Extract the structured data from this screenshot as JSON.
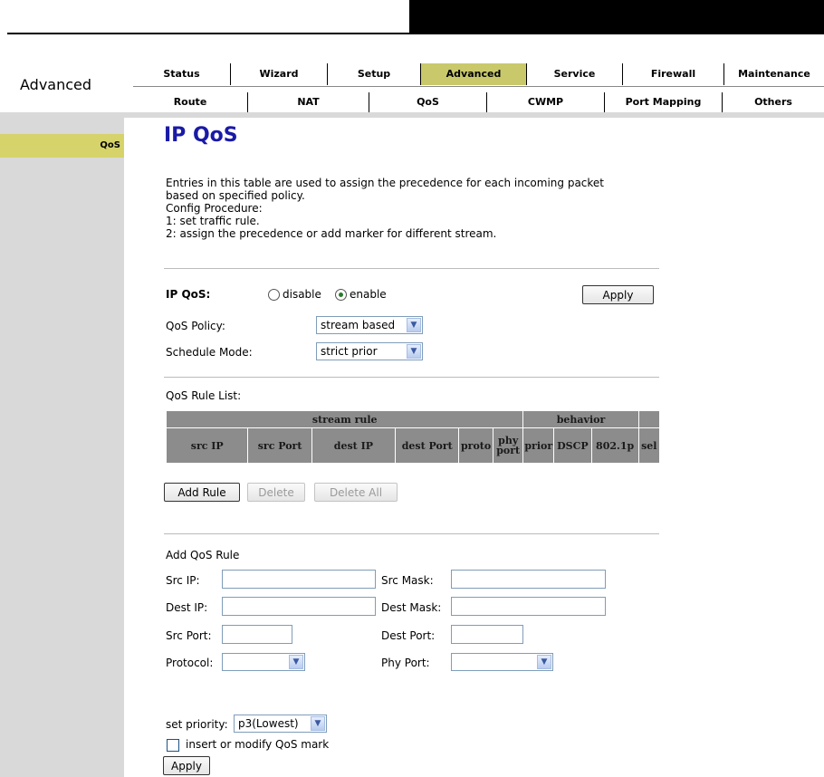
{
  "header": {
    "section_title": "Advanced",
    "main_tabs": [
      "Status",
      "Wizard",
      "Setup",
      "Advanced",
      "Service",
      "Firewall",
      "Maintenance"
    ],
    "active_main_tab": "Advanced",
    "sub_tabs": [
      "Route",
      "NAT",
      "QoS",
      "CWMP",
      "Port Mapping",
      "Others"
    ]
  },
  "sidebar": {
    "items": [
      "QoS"
    ]
  },
  "main": {
    "title": "IP QoS",
    "description": [
      "Entries in this table are used to assign the precedence for each incoming packet",
      "based on specified policy.",
      "Config Procedure:",
      "1: set traffic rule.",
      "2: assign the precedence or add marker for different stream."
    ],
    "ipqos": {
      "label": "IP QoS:",
      "disable_label": "disable",
      "enable_label": "enable",
      "selected": "enable",
      "apply_label": "Apply"
    },
    "qos_policy": {
      "label": "QoS Policy:",
      "value": "stream based"
    },
    "schedule_mode": {
      "label": "Schedule Mode:",
      "value": "strict prior"
    },
    "rule_list": {
      "label": "QoS Rule List:",
      "group_headers": [
        "stream rule",
        "behavior",
        ""
      ],
      "columns": [
        "src IP",
        "src Port",
        "dest IP",
        "dest Port",
        "proto",
        "phy port",
        "prior",
        "DSCP",
        "802.1p",
        "sel"
      ],
      "buttons": {
        "add": "Add Rule",
        "delete": "Delete",
        "delete_all": "Delete All"
      }
    },
    "add_rule": {
      "title": "Add QoS Rule",
      "src_ip_label": "Src IP:",
      "src_mask_label": "Src Mask:",
      "dest_ip_label": "Dest IP:",
      "dest_mask_label": "Dest Mask:",
      "src_port_label": "Src Port:",
      "dest_port_label": "Dest Port:",
      "protocol_label": "Protocol:",
      "protocol_value": "",
      "phy_port_label": "Phy Port:",
      "phy_port_value": "",
      "set_priority_label": "set priority:",
      "priority_value": "p3(Lowest)",
      "insert_mark_label": "insert or modify QoS mark",
      "apply_label": "Apply"
    }
  },
  "colors": {
    "active_tab": "#c9c96b",
    "sidebar_bg": "#d9d9d9",
    "sidebar_active": "#d6d36b",
    "title": "#1a1aa6",
    "table_header": "#8c8c8c"
  }
}
